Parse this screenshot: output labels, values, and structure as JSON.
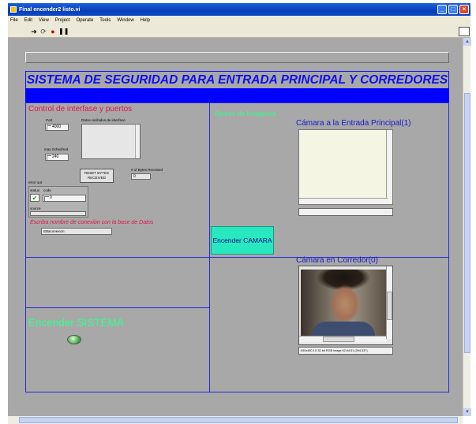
{
  "window": {
    "title": "Final encender2 listo.vi",
    "controls": [
      "minimize-icon",
      "maximize-icon",
      "close-icon"
    ]
  },
  "menu": [
    "File",
    "Edit",
    "View",
    "Project",
    "Operate",
    "Tools",
    "Window",
    "Help"
  ],
  "toolbar": {
    "buttons": [
      "run-arrow-icon",
      "run-continuous-icon",
      "abort-icon",
      "pause-icon"
    ]
  },
  "main_title": "SISTEMA DE SEGURIDAD PARA  ENTRADA PRINCIPAL Y CORREDORES",
  "left_panel": {
    "title": "Control de interfase y puertos",
    "port_label": "Port",
    "port_value": "4000",
    "max_backlog_label": "max Sched/red",
    "max_backlog_value": "240",
    "datos_label": "Datos recibidos de interface",
    "reset_button": "RESET BYTES RECEIVED",
    "bytes_received_label": "# of Bytes Received",
    "bytes_received_value": "0",
    "error_out": {
      "label": "error out",
      "status_label": "status",
      "code_label": "code",
      "code_value": "0",
      "source_label": "source"
    },
    "db_prompt": "Escriba nombre de conexión con la base de Datos",
    "db_value": "EBaconexion"
  },
  "system_switch": {
    "label": "Encender SISTEMA"
  },
  "right_panel": {
    "visores_title": "Visores de Imágenes",
    "camera1_title": "Cámara a la Entrada Principal(1)",
    "camera_button": "Encender CAMARA",
    "camera0_title": "Cámara en Corredor(0)",
    "camera0_status": "640x480 1X 32-bit RGB image 62,64,51     (264,337)"
  },
  "colors": {
    "panel": "#a8a8a8",
    "title_blue": "#1010ee",
    "band_blue": "#0000ff",
    "frame_blue": "#2828d8",
    "red_text": "#e0144c",
    "green_text": "#30ff90",
    "camera_button": "#28e8c0"
  }
}
